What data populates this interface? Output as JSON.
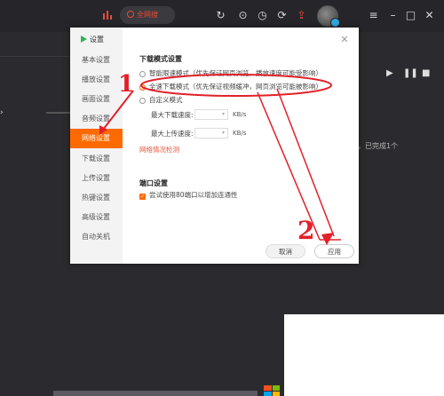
{
  "topbar": {
    "search_label": "全网搜",
    "icons": [
      "chart-icon",
      "refresh-icon",
      "check-circle-icon",
      "clock-icon",
      "cloud-sync-icon",
      "upload-icon",
      "avatar",
      "star-badge-icon",
      "menu-icon",
      "minimize-icon",
      "maximize-icon",
      "close-icon"
    ]
  },
  "background": {
    "status_text": "，已完成1个",
    "colors": {
      "accent": "#ff6a00",
      "dark_bg": "#2b2b2f"
    }
  },
  "dialog": {
    "title": "设置",
    "sidebar": {
      "items": [
        {
          "label": "基本设置"
        },
        {
          "label": "播放设置"
        },
        {
          "label": "画面设置"
        },
        {
          "label": "音频设置"
        },
        {
          "label": "网络设置",
          "active": true
        },
        {
          "label": "下载设置"
        },
        {
          "label": "上传设置"
        },
        {
          "label": "热键设置"
        },
        {
          "label": "高级设置"
        },
        {
          "label": "自动关机"
        }
      ]
    },
    "download_mode": {
      "title": "下载模式设置",
      "option1": "智能限速模式（优先保证网页浏览，播放速度可能受影响）",
      "option2": "全速下载模式（优先保证视频缓冲，网页浏览可能被影响）",
      "option3": "自定义模式",
      "selected": 2,
      "max_download_label": "最大下载速度:",
      "max_upload_label": "最大上传速度:",
      "unit": "KB/s",
      "network_check_link": "网络情况检测"
    },
    "port": {
      "title": "端口设置",
      "checkbox_label": "尝试使用80端口以增加连通性",
      "checked": true
    },
    "buttons": {
      "cancel": "取消",
      "apply": "应用"
    }
  },
  "annotations": {
    "step1": "1",
    "step2": "2",
    "color": "#e2202a"
  }
}
